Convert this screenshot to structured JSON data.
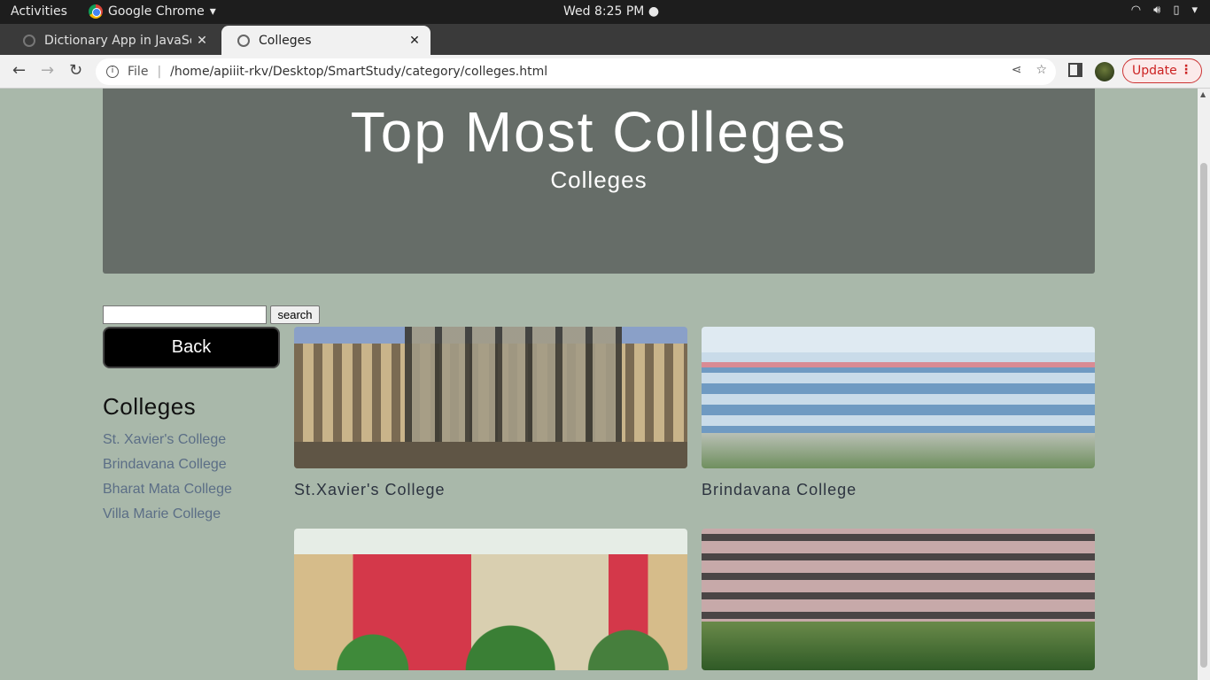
{
  "os_bar": {
    "activities": "Activities",
    "app_name": "Google Chrome",
    "clock": "Wed  8:25 PM"
  },
  "tabs": [
    {
      "label": "Dictionary App in JavaScr",
      "active": false
    },
    {
      "label": "Colleges",
      "active": true
    }
  ],
  "toolbar": {
    "scheme": "File",
    "url": "/home/apiiit-rkv/Desktop/SmartStudy/category/colleges.html",
    "update_label": "Update"
  },
  "hero": {
    "title": "Top Most Colleges",
    "subtitle": "Colleges"
  },
  "search": {
    "value": "",
    "button_label": "search"
  },
  "back_label": "Back",
  "sidebar": {
    "title": "Colleges",
    "links": [
      {
        "label": "St. Xavier's College"
      },
      {
        "label": "Brindavana College"
      },
      {
        "label": "Bharat Mata College"
      },
      {
        "label": "Villa Marie College"
      }
    ]
  },
  "cards": [
    {
      "caption": "St.Xavier's College"
    },
    {
      "caption": "Brindavana College"
    },
    {
      "caption": ""
    },
    {
      "caption": ""
    }
  ],
  "colors": {
    "page_bg": "#a9b8aa",
    "hero_bg": "#666d68",
    "link": "#5b6e86",
    "update_red": "#cc2222"
  }
}
